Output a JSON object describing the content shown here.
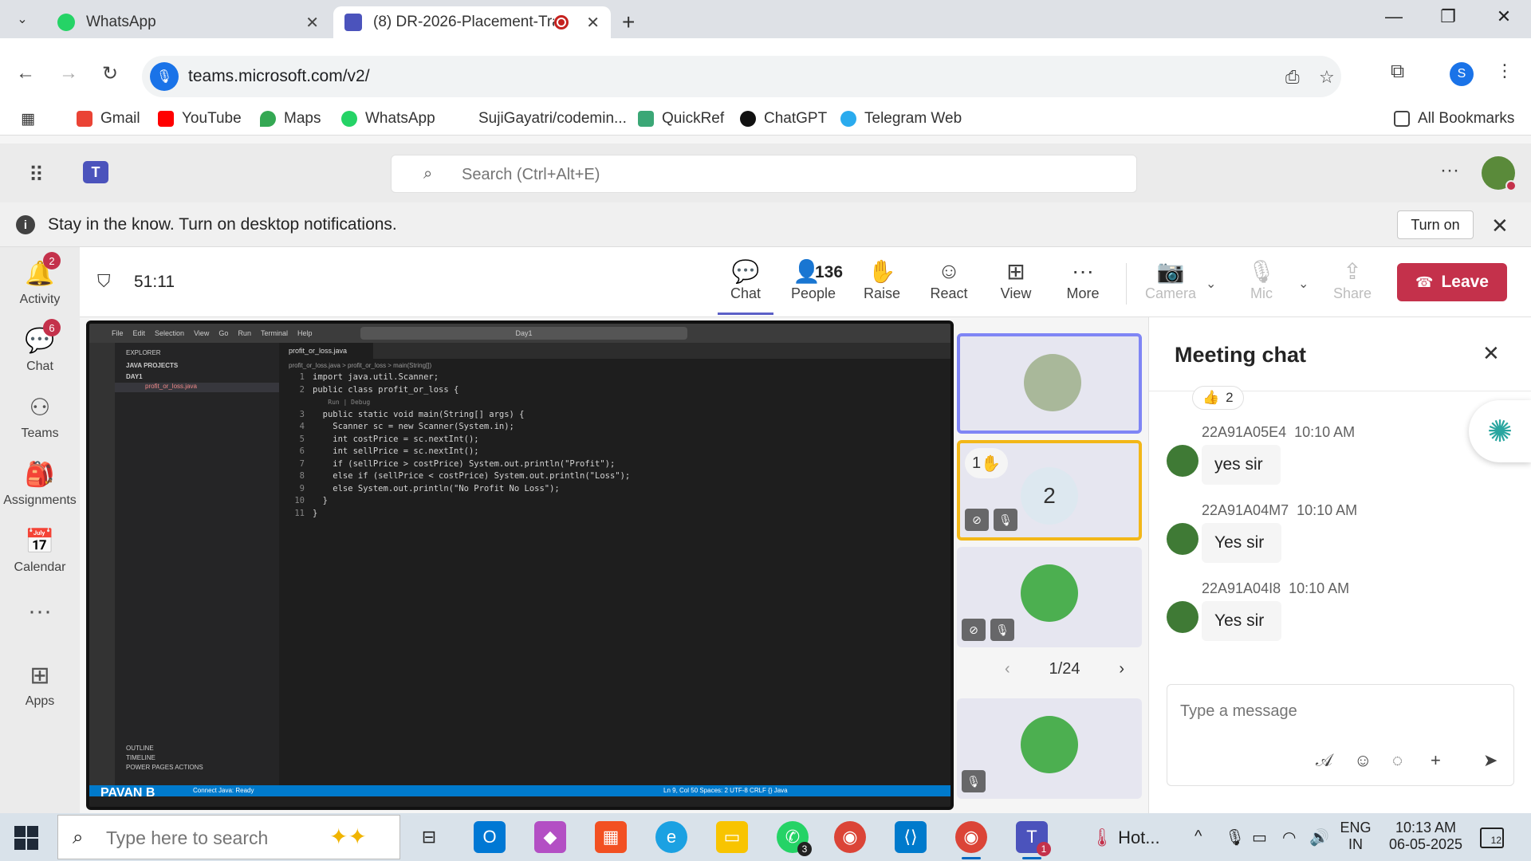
{
  "browser": {
    "tabs": [
      {
        "title": "WhatsApp",
        "active": false
      },
      {
        "title": "(8) DR-2026-Placement-Trai",
        "active": true
      }
    ],
    "url": "teams.microsoft.com/v2/",
    "profile_initial": "S",
    "bookmarks": [
      "Gmail",
      "YouTube",
      "Maps",
      "WhatsApp",
      "SujiGayatri/codemin...",
      "QuickRef",
      "ChatGPT",
      "Telegram Web"
    ],
    "all_bookmarks": "All Bookmarks"
  },
  "teams": {
    "search_placeholder": "Search (Ctrl+Alt+E)",
    "notification": {
      "message": "Stay in the know. Turn on desktop notifications.",
      "action": "Turn on"
    },
    "rail": [
      {
        "label": "Activity",
        "badge": "2"
      },
      {
        "label": "Chat",
        "badge": "6"
      },
      {
        "label": "Teams",
        "badge": ""
      },
      {
        "label": "Assignments",
        "badge": ""
      },
      {
        "label": "Calendar",
        "badge": ""
      },
      {
        "label": "Apps",
        "badge": ""
      }
    ]
  },
  "meeting": {
    "timer": "51:11",
    "people_count": "136",
    "toolbar": {
      "chat": "Chat",
      "people": "People",
      "raise": "Raise",
      "react": "React",
      "view": "View",
      "more": "More",
      "camera": "Camera",
      "mic": "Mic",
      "share": "Share",
      "leave": "Leave"
    },
    "presenter_name": "PAVAN B",
    "raised_hand_count": "1",
    "tile_number": "2",
    "pager": "1/24"
  },
  "shared_screen": {
    "menu": [
      "File",
      "Edit",
      "Selection",
      "View",
      "Go",
      "Run",
      "Terminal",
      "Help"
    ],
    "search": "Day1",
    "explorer_title": "EXPLORER",
    "project_header": "JAVA PROJECTS",
    "folder": "DAY1",
    "file": "profit_or_loss.java",
    "tab": "profit_or_loss.java",
    "breadcrumb": "profit_or_loss.java > profit_or_loss > main(String[])",
    "outline": [
      "OUTLINE",
      "TIMELINE",
      "POWER PAGES ACTIONS"
    ],
    "status_left": "Connect    Java: Ready",
    "status_right": "Ln 9, Col 50   Spaces: 2   UTF-8   CRLF   {} Java",
    "code": [
      {
        "n": "1",
        "t": "import java.util.Scanner;"
      },
      {
        "n": "2",
        "t": "public class profit_or_loss {"
      },
      {
        "n": "",
        "t": "    Run | Debug"
      },
      {
        "n": "3",
        "t": "  public static void main(String[] args) {"
      },
      {
        "n": "4",
        "t": "    Scanner sc = new Scanner(System.in);"
      },
      {
        "n": "5",
        "t": "    int costPrice = sc.nextInt();"
      },
      {
        "n": "6",
        "t": "    int sellPrice = sc.nextInt();"
      },
      {
        "n": "7",
        "t": "    if (sellPrice > costPrice) System.out.println(\"Profit\");"
      },
      {
        "n": "8",
        "t": "    else if (sellPrice < costPrice) System.out.println(\"Loss\");"
      },
      {
        "n": "9",
        "t": "    else System.out.println(\"No Profit No Loss\");"
      },
      {
        "n": "10",
        "t": "  }"
      },
      {
        "n": "11",
        "t": "}"
      }
    ]
  },
  "chat": {
    "title": "Meeting chat",
    "reaction_count": "2",
    "messages": [
      {
        "sender": "22A91A05E4",
        "time": "10:10 AM",
        "text": "yes sir"
      },
      {
        "sender": "22A91A04M7",
        "time": "10:10 AM",
        "text": "Yes sir"
      },
      {
        "sender": "22A91A04I8",
        "time": "10:10 AM",
        "text": "Yes sir"
      }
    ],
    "compose_placeholder": "Type a message"
  },
  "taskbar": {
    "search_placeholder": "Type here to search",
    "whatsapp_badge": "3",
    "teams_badge": "1",
    "hot_label": "Hot...",
    "lang": "ENG",
    "region": "IN",
    "time": "10:13 AM",
    "date": "06-05-2025",
    "notifications": "12"
  },
  "colors": {
    "teams_purple": "#5b5fc7",
    "leave_red": "#c4314b",
    "badge_red": "#c4314b",
    "raise_border": "#f2b718"
  }
}
